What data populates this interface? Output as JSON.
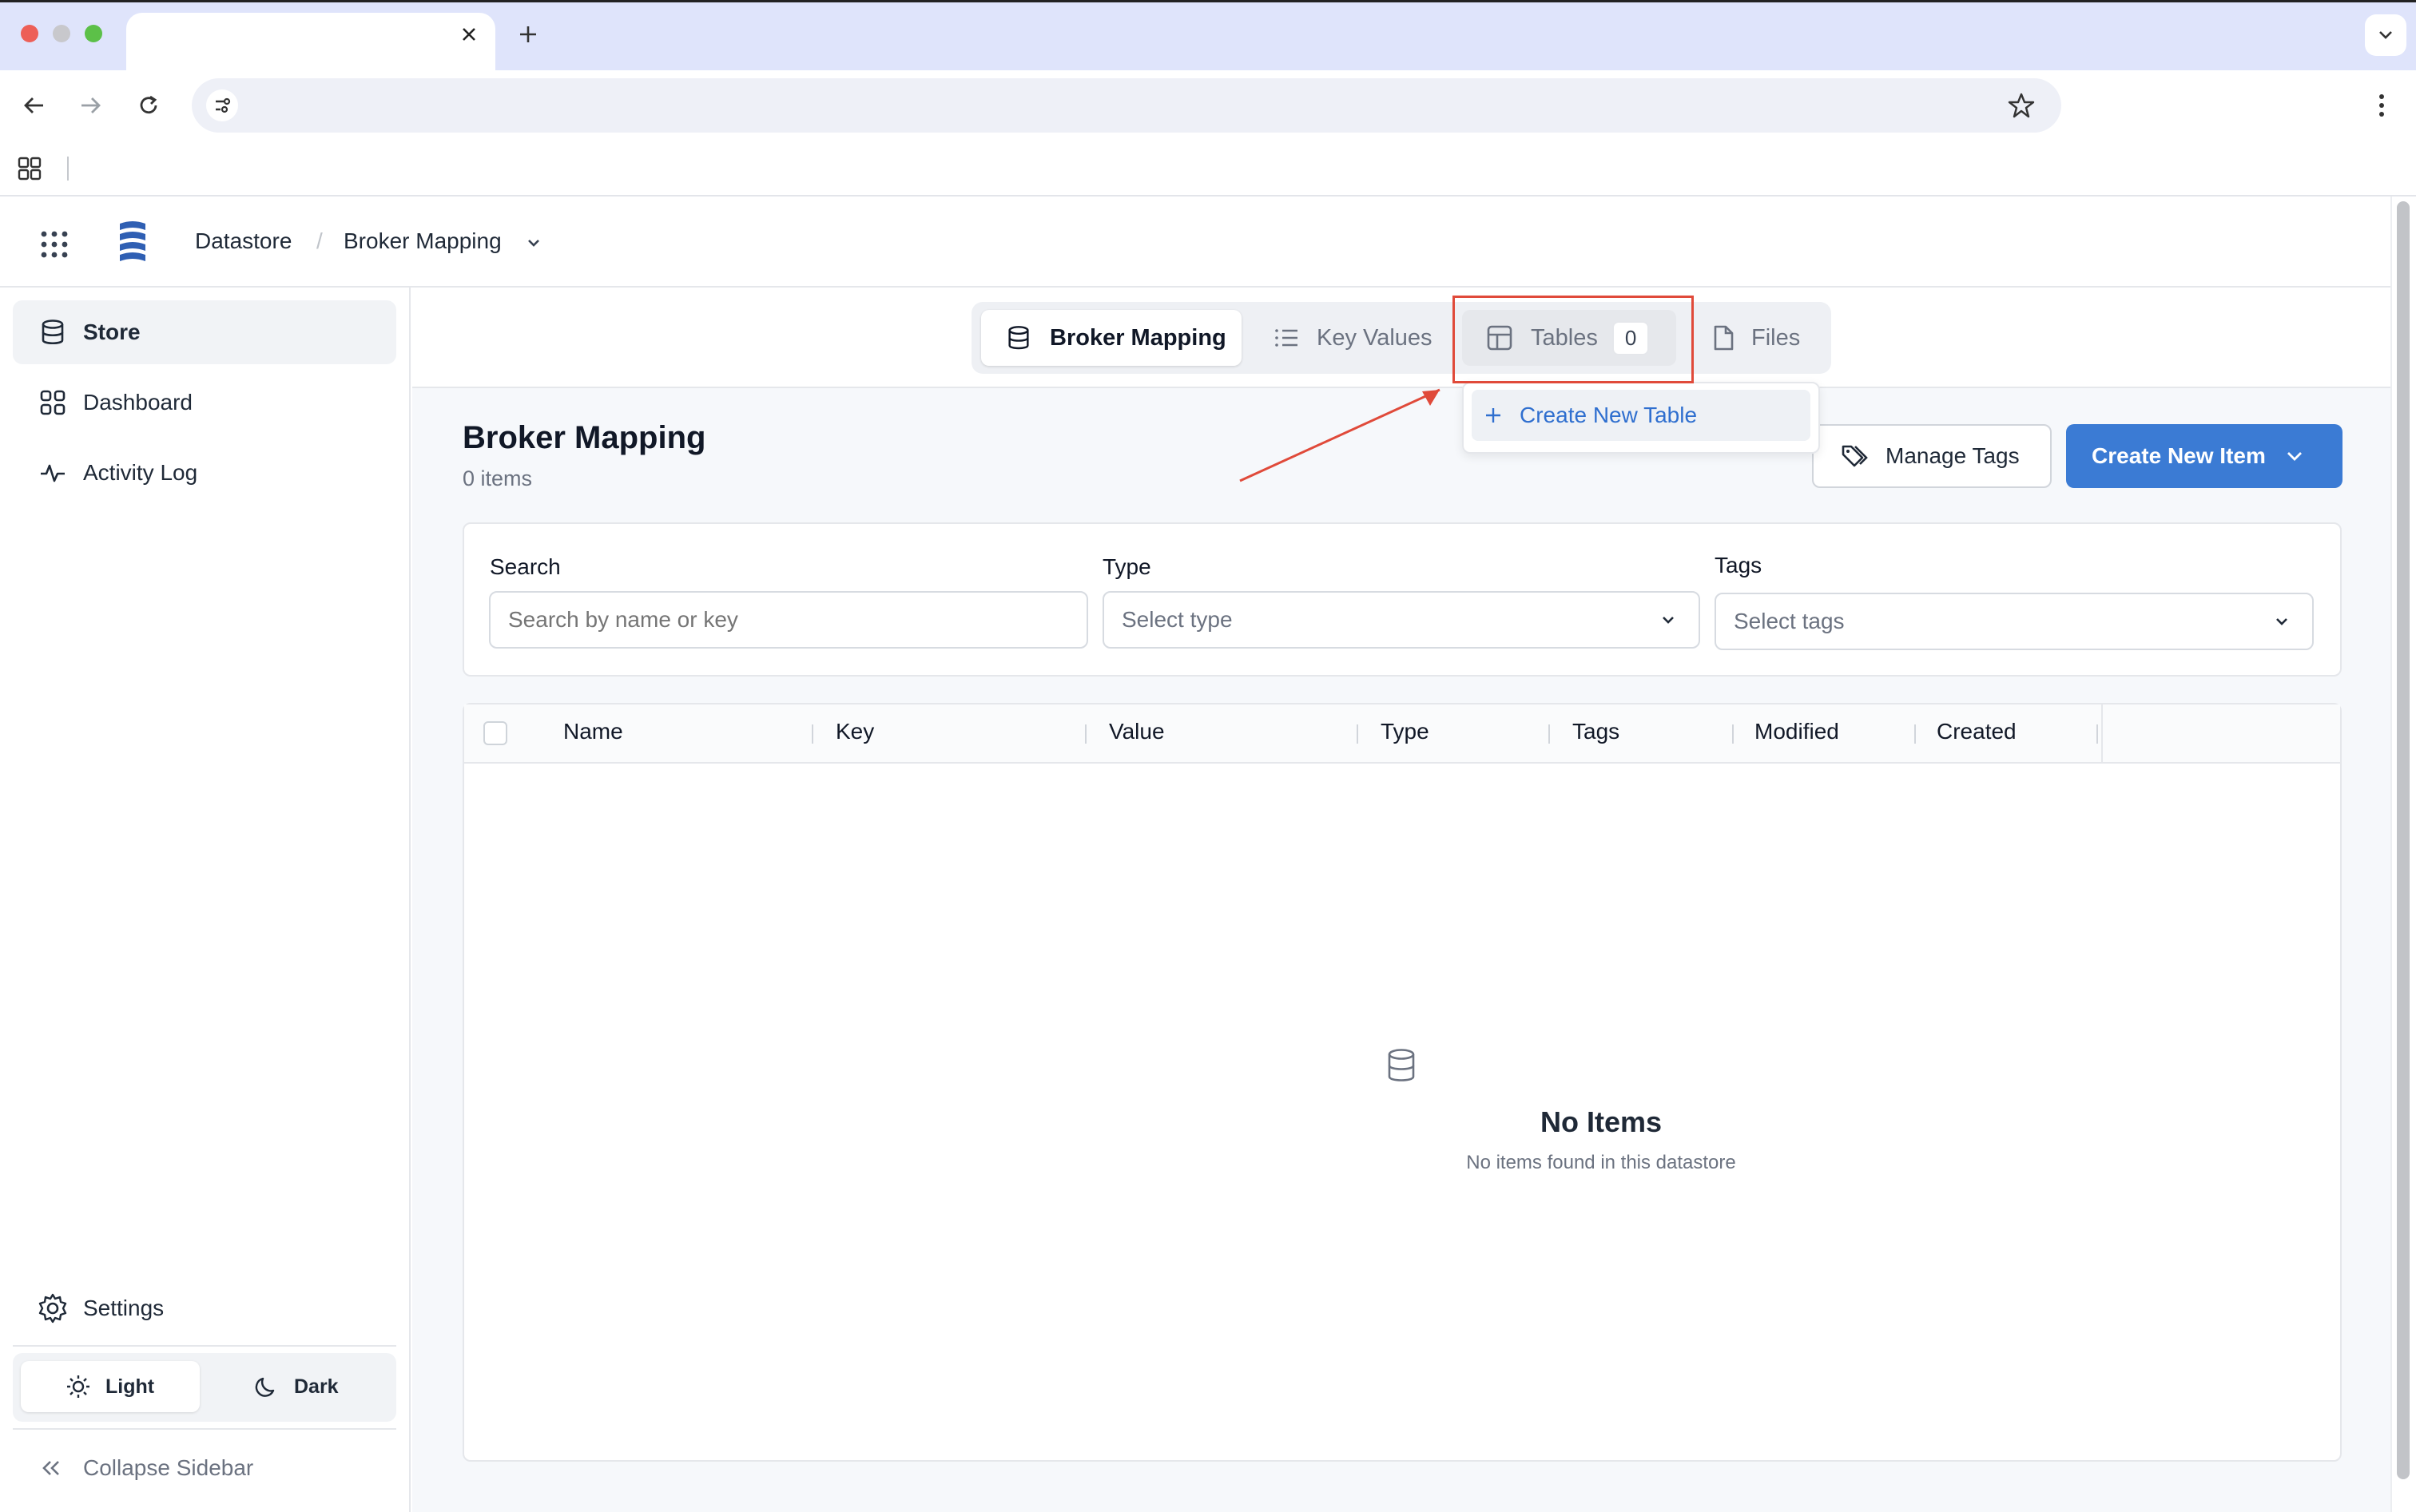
{
  "browser": {
    "tab_title": "",
    "address": ""
  },
  "header": {
    "breadcrumb_root": "Datastore",
    "breadcrumb_separator": "/",
    "breadcrumb_current": "Broker Mapping"
  },
  "sidebar": {
    "items": [
      {
        "label": "Store",
        "icon": "database-icon",
        "active": true
      },
      {
        "label": "Dashboard",
        "icon": "grid-icon",
        "active": false
      },
      {
        "label": "Activity Log",
        "icon": "activity-icon",
        "active": false
      }
    ],
    "settings_label": "Settings",
    "theme_light": "Light",
    "theme_dark": "Dark",
    "collapse_label": "Collapse Sidebar"
  },
  "tabs": {
    "items": [
      {
        "label": "Broker Mapping",
        "icon": "database-icon"
      },
      {
        "label": "Key Values",
        "icon": "list-icon"
      },
      {
        "label": "Tables",
        "icon": "table-icon",
        "badge": "0"
      },
      {
        "label": "Files",
        "icon": "file-icon"
      }
    ],
    "tables_menu_item": "Create New Table"
  },
  "page": {
    "title": "Broker Mapping",
    "subtitle": "0 items",
    "manage_tags": "Manage Tags",
    "create_item": "Create New Item"
  },
  "filters": {
    "search_label": "Search",
    "search_placeholder": "Search by name or key",
    "type_label": "Type",
    "type_placeholder": "Select type",
    "tags_label": "Tags",
    "tags_placeholder": "Select tags"
  },
  "table": {
    "columns": [
      "Name",
      "Key",
      "Value",
      "Type",
      "Tags",
      "Modified",
      "Created"
    ],
    "empty_title": "No Items",
    "empty_subtitle": "No items found in this datastore"
  },
  "colors": {
    "accent": "#3b7bd4",
    "annotation": "#e04a3a"
  }
}
